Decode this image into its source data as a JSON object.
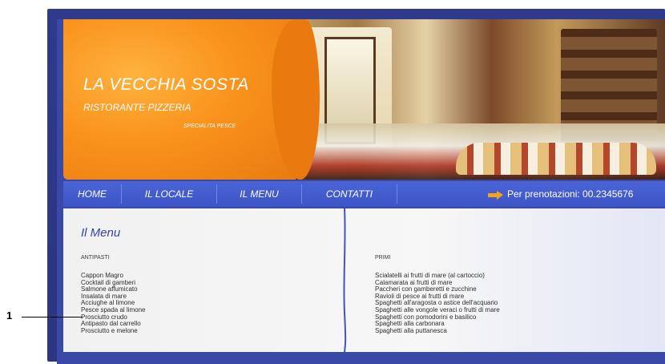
{
  "header": {
    "brand_name": "LA VECCHIA SOSTA",
    "brand_subtitle": "RISTORANTE PIZZERIA",
    "brand_specialty": "SPECIALITA PESCE"
  },
  "nav": {
    "items": [
      {
        "label": "HOME"
      },
      {
        "label": "IL LOCALE"
      },
      {
        "label": "IL MENU"
      },
      {
        "label": "CONTATTI"
      }
    ],
    "booking_text": "Per prenotazioni: 00.2345676"
  },
  "menu": {
    "title": "Il Menu",
    "antipasti": {
      "heading": "ANTIPASTI",
      "items": [
        "Cappon Magro",
        "Cocktail di gamberi",
        "Salmone affumicato",
        "Insalata di mare",
        "Acciughe al limone",
        "Pesce spada al limone",
        "Prosciutto crudo",
        "Antipasto dal carrello",
        "Prosciutto e melone"
      ]
    },
    "primi": {
      "heading": "PRIMI",
      "items": [
        "Scialatelli ai frutti di mare (al cartoccio)",
        "Calamarata ai frutti di mare",
        "Paccheri con gamberetti e zucchine",
        "Ravioli di pesce ai frutti di mare",
        "Spaghetti all'aragosta o astice dell'acquario",
        "Spaghetti alle vongole veraci o frutti di mare",
        "Spaghetti con pomodorini e basilico",
        "Spaghetti alla carbonara",
        "Spaghetti alla puttanesca"
      ]
    }
  },
  "callout": {
    "number": "1"
  },
  "colors": {
    "frame": "#2f3a8a",
    "nav": "#4a64d6",
    "accent_orange": "#f9931c",
    "title_blue": "#3344a8"
  }
}
